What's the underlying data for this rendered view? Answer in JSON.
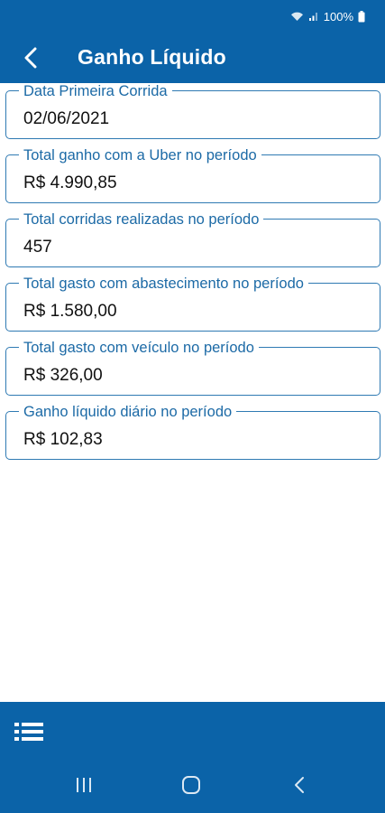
{
  "status": {
    "battery_text": "100%"
  },
  "header": {
    "title": "Ganho Líquido"
  },
  "fields": [
    {
      "label": "Data Primeira Corrida",
      "value": "02/06/2021"
    },
    {
      "label": "Total ganho com a Uber no período",
      "value": "R$ 4.990,85"
    },
    {
      "label": "Total corridas realizadas no período",
      "value": "457"
    },
    {
      "label": "Total gasto com abastecimento no período",
      "value": "R$ 1.580,00"
    },
    {
      "label": "Total gasto com veículo no período",
      "value": "R$ 326,00"
    },
    {
      "label": "Ganho líquido diário no período",
      "value": "R$ 102,83"
    }
  ],
  "icons": {
    "back": "arrow-back-icon",
    "list": "list-icon",
    "nav_recents": "recents-icon",
    "nav_home": "home-icon",
    "nav_back": "nav-back-icon"
  },
  "colors": {
    "primary": "#0b63a8",
    "label": "#1c6aa6",
    "field_border": "#2f7ab3"
  }
}
